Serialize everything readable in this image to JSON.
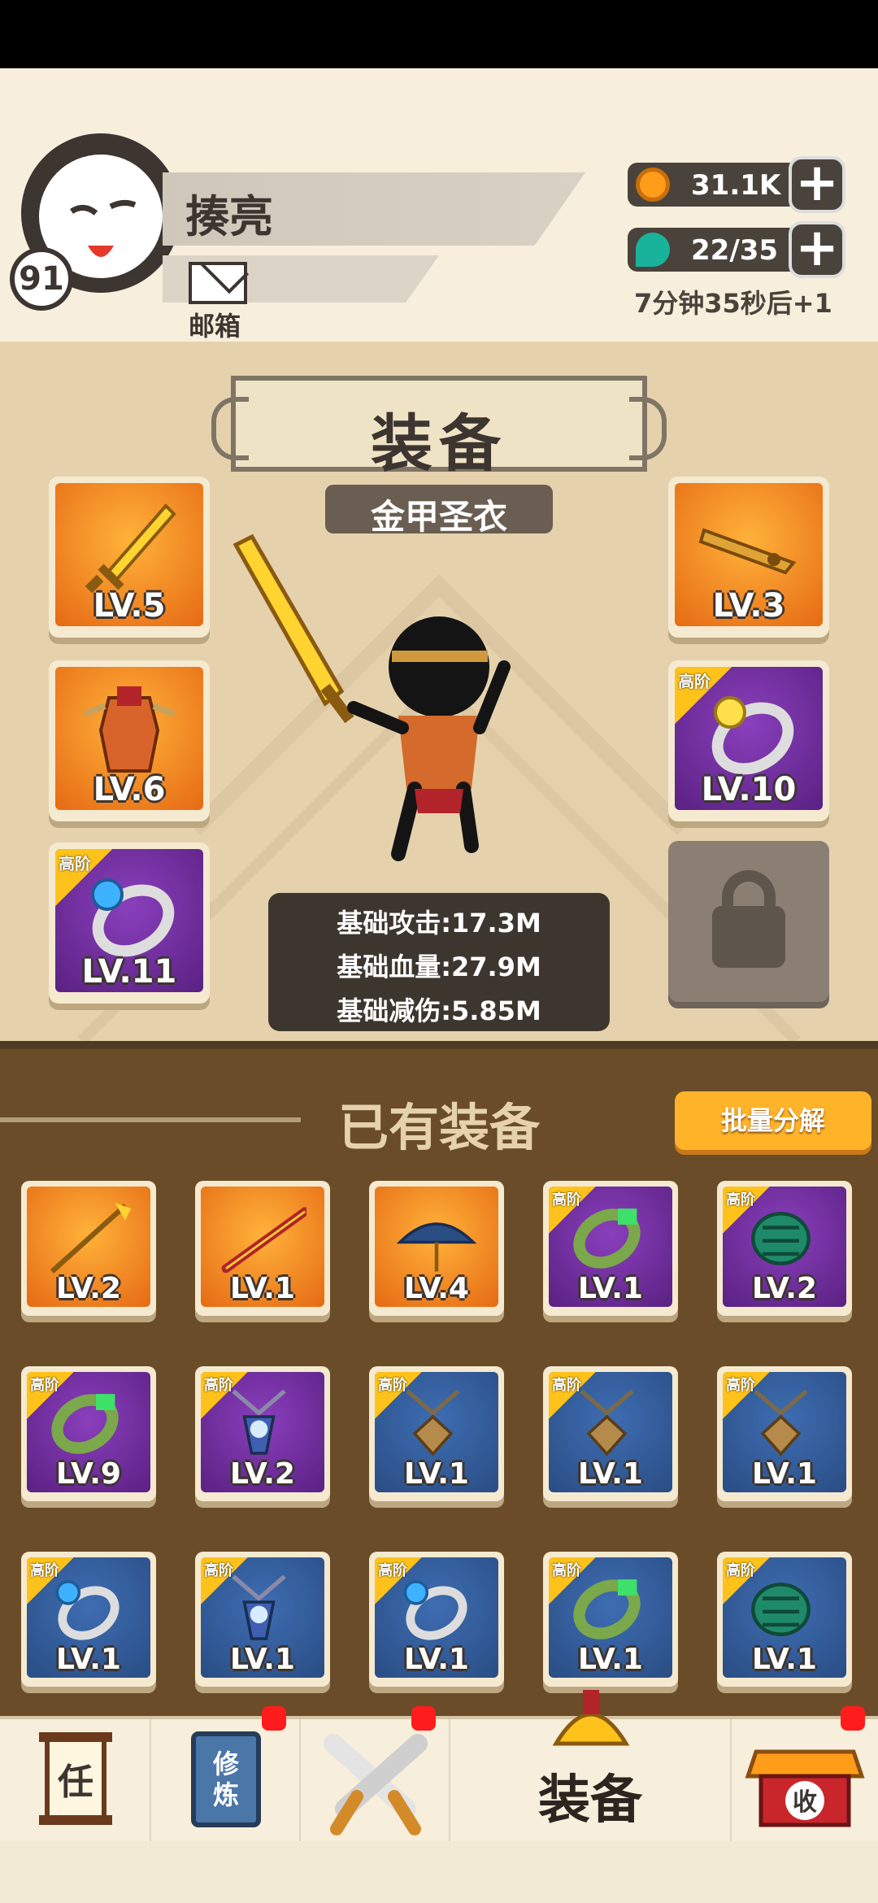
{
  "player": {
    "name": "揍亮",
    "level": "91"
  },
  "mail": {
    "label": "邮箱"
  },
  "resources": [
    {
      "icon": "coin-icon",
      "value": "31.1K",
      "color": "#ff9c1a"
    },
    {
      "icon": "stamina-gem-icon",
      "value": "22/35",
      "color": "#19b39b"
    }
  ],
  "timer": "7分钟35秒后+1",
  "equip": {
    "title": "装备",
    "set_name": "金甲圣衣",
    "slots": [
      {
        "name": "equip-slot-sword",
        "rarity": "orange",
        "level": "LV.5",
        "icon": "golden-sword-icon"
      },
      {
        "name": "equip-slot-armor",
        "rarity": "orange",
        "level": "LV.6",
        "icon": "armor-icon"
      },
      {
        "name": "equip-slot-ring-left",
        "rarity": "purple",
        "level": "LV.11",
        "tier": "高阶",
        "icon": "blue-gem-ring-icon"
      },
      {
        "name": "equip-slot-weapon-2",
        "rarity": "orange",
        "level": "LV.3",
        "icon": "golden-blade-icon"
      },
      {
        "name": "equip-slot-ring-right",
        "rarity": "purple",
        "level": "LV.10",
        "tier": "高阶",
        "icon": "yellow-gem-ring-icon"
      }
    ],
    "locked_slot_icon": "lock-icon",
    "stats": [
      "基础攻击:17.3M",
      "基础血量:27.9M",
      "基础减伤:5.85M"
    ]
  },
  "inventory": {
    "title": "已有装备",
    "bulk_button": "批量分解",
    "items": [
      {
        "rarity": "orange",
        "level": "LV.2",
        "icon": "spear-icon"
      },
      {
        "rarity": "orange",
        "level": "LV.1",
        "icon": "staff-icon"
      },
      {
        "rarity": "orange",
        "level": "LV.4",
        "icon": "umbrella-icon"
      },
      {
        "rarity": "purple",
        "level": "LV.1",
        "tier": "高阶",
        "icon": "jade-bracelet-icon"
      },
      {
        "rarity": "purple",
        "level": "LV.2",
        "tier": "高阶",
        "icon": "green-bracer-icon"
      },
      {
        "rarity": "purple",
        "level": "LV.9",
        "tier": "高阶",
        "icon": "jade-bracelet-icon"
      },
      {
        "rarity": "purple",
        "level": "LV.2",
        "tier": "高阶",
        "icon": "pendant-icon"
      },
      {
        "rarity": "blue",
        "level": "LV.1",
        "tier": "高阶",
        "icon": "amulet-icon"
      },
      {
        "rarity": "blue",
        "level": "LV.1",
        "tier": "高阶",
        "icon": "amulet-icon"
      },
      {
        "rarity": "blue",
        "level": "LV.1",
        "tier": "高阶",
        "icon": "amulet-icon"
      },
      {
        "rarity": "blue",
        "level": "LV.1",
        "tier": "高阶",
        "icon": "blue-gem-ring-icon"
      },
      {
        "rarity": "blue",
        "level": "LV.1",
        "tier": "高阶",
        "icon": "pendant-icon"
      },
      {
        "rarity": "blue",
        "level": "LV.1",
        "tier": "高阶",
        "icon": "blue-gem-ring-icon"
      },
      {
        "rarity": "blue",
        "level": "LV.1",
        "tier": "高阶",
        "icon": "jade-bracelet-icon"
      },
      {
        "rarity": "blue",
        "level": "LV.1",
        "tier": "高阶",
        "icon": "green-bracer-icon"
      }
    ]
  },
  "nav": [
    {
      "name": "nav-tasks",
      "icon": "task-scroll-icon",
      "glyph": "任",
      "badge": false
    },
    {
      "name": "nav-training",
      "icon": "training-book-icon",
      "glyph": "修炼",
      "badge": true
    },
    {
      "name": "nav-battle",
      "icon": "crossed-swords-icon",
      "badge": true
    },
    {
      "name": "nav-equipment",
      "icon": "helmet-icon",
      "label": "装备",
      "badge": false,
      "active": true
    },
    {
      "name": "nav-collect",
      "icon": "shop-collect-icon",
      "glyph": "收",
      "badge": true
    }
  ]
}
